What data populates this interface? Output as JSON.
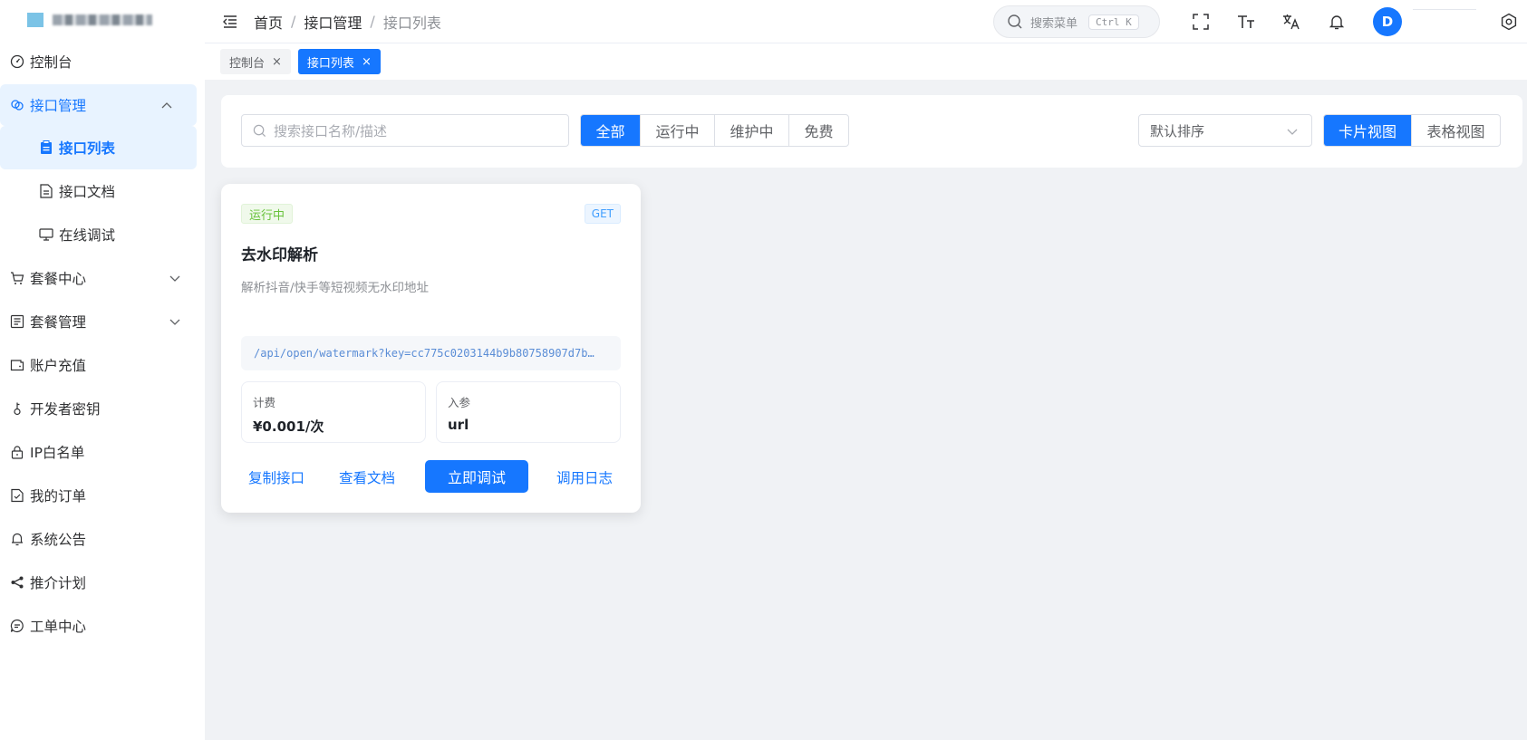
{
  "sidebar": {
    "items": [
      {
        "label": "控制台",
        "icon": "dashboard-icon"
      },
      {
        "label": "接口管理",
        "icon": "link-icon",
        "expanded": true
      },
      {
        "label": "接口列表",
        "icon": "clipboard-icon",
        "active": true
      },
      {
        "label": "接口文档",
        "icon": "document-icon"
      },
      {
        "label": "在线调试",
        "icon": "monitor-icon"
      },
      {
        "label": "套餐中心",
        "icon": "cart-icon"
      },
      {
        "label": "套餐管理",
        "icon": "list-icon"
      },
      {
        "label": "账户充值",
        "icon": "wallet-icon"
      },
      {
        "label": "开发者密钥",
        "icon": "key-icon"
      },
      {
        "label": "IP白名单",
        "icon": "lock-icon"
      },
      {
        "label": "我的订单",
        "icon": "order-icon"
      },
      {
        "label": "系统公告",
        "icon": "bell-icon"
      },
      {
        "label": "推介计划",
        "icon": "share-icon"
      },
      {
        "label": "工单中心",
        "icon": "chat-icon"
      }
    ]
  },
  "header": {
    "breadcrumb": [
      "首页",
      "接口管理",
      "接口列表"
    ],
    "search_label": "搜索菜单",
    "search_shortcut": "Ctrl K",
    "avatar_initial": "D"
  },
  "tabs": [
    {
      "label": "控制台",
      "active": false
    },
    {
      "label": "接口列表",
      "active": true
    }
  ],
  "filters": {
    "search_placeholder": "搜索接口名称/描述",
    "status_options": [
      "全部",
      "运行中",
      "维护中",
      "免费"
    ],
    "sort_value": "默认排序",
    "view_options": [
      "卡片视图",
      "表格视图"
    ]
  },
  "card": {
    "status": "运行中",
    "method": "GET",
    "title": "去水印解析",
    "description": "解析抖音/快手等短视频无水印地址",
    "url": "/api/open/watermark?key=cc775c0203144b9b80758907d7b…",
    "fee_label": "计费",
    "fee_value": "¥0.001/次",
    "param_label": "入参",
    "param_value": "url",
    "actions": {
      "copy": "复制接口",
      "docs": "查看文档",
      "debug": "立即调试",
      "logs": "调用日志"
    }
  },
  "colors": {
    "primary": "#1677ff",
    "success": "#67c23a",
    "background": "#f0f2f5"
  }
}
